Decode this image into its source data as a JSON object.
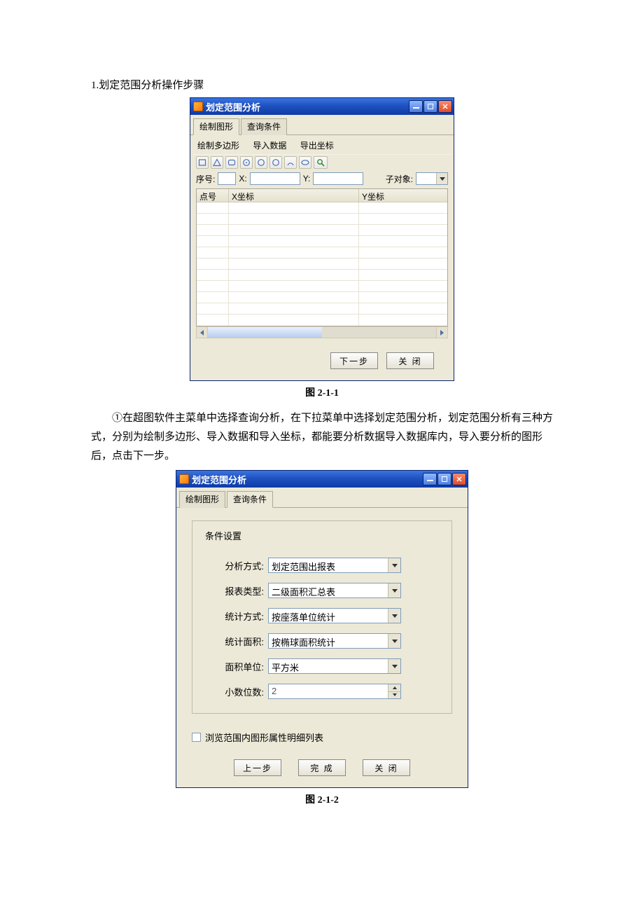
{
  "doc": {
    "section_title": "1.划定范围分析操作步骤",
    "caption1": "图 2-1-1",
    "caption2": "图 2-1-2",
    "paragraph": "①在超图软件主菜单中选择查询分析，在下拉菜单中选择划定范围分析，划定范围分析有三种方式，分别为绘制多边形、导入数据和导入坐标，都能要分析数据导入数据库内，导入要分析的图形后，点击下一步。"
  },
  "win1": {
    "title": "划定范围分析",
    "tabs": {
      "draw": "绘制图形",
      "query": "查询条件"
    },
    "menu": {
      "polygon": "绘制多边形",
      "importData": "导入数据",
      "exportCoord": "导出坐标"
    },
    "labels": {
      "seq": "序号:",
      "x": "X:",
      "y": "Y:",
      "subobj": "子对象:"
    },
    "grid_headers": {
      "pt": "点号",
      "xCoord": "X坐标",
      "yCoord": "Y坐标"
    },
    "buttons": {
      "next": "下一步",
      "close": "关 闭"
    }
  },
  "win2": {
    "title": "划定范围分析",
    "tabs": {
      "draw": "绘制图形",
      "query": "查询条件"
    },
    "fieldset_title": "条件设置",
    "labels": {
      "analysisMode": "分析方式:",
      "reportType": "报表类型:",
      "statMode": "统计方式:",
      "statArea": "统计面积:",
      "areaUnit": "面积单位:",
      "decimals": "小数位数:"
    },
    "values": {
      "analysisMode": "划定范围出报表",
      "reportType": "二级面积汇总表",
      "statMode": "按座落单位统计",
      "statArea": "按椭球面积统计",
      "areaUnit": "平方米",
      "decimals": "2"
    },
    "checkbox_label": "浏览范围内图形属性明细列表",
    "buttons": {
      "prev": "上一步",
      "finish": "完 成",
      "close": "关 闭"
    }
  }
}
